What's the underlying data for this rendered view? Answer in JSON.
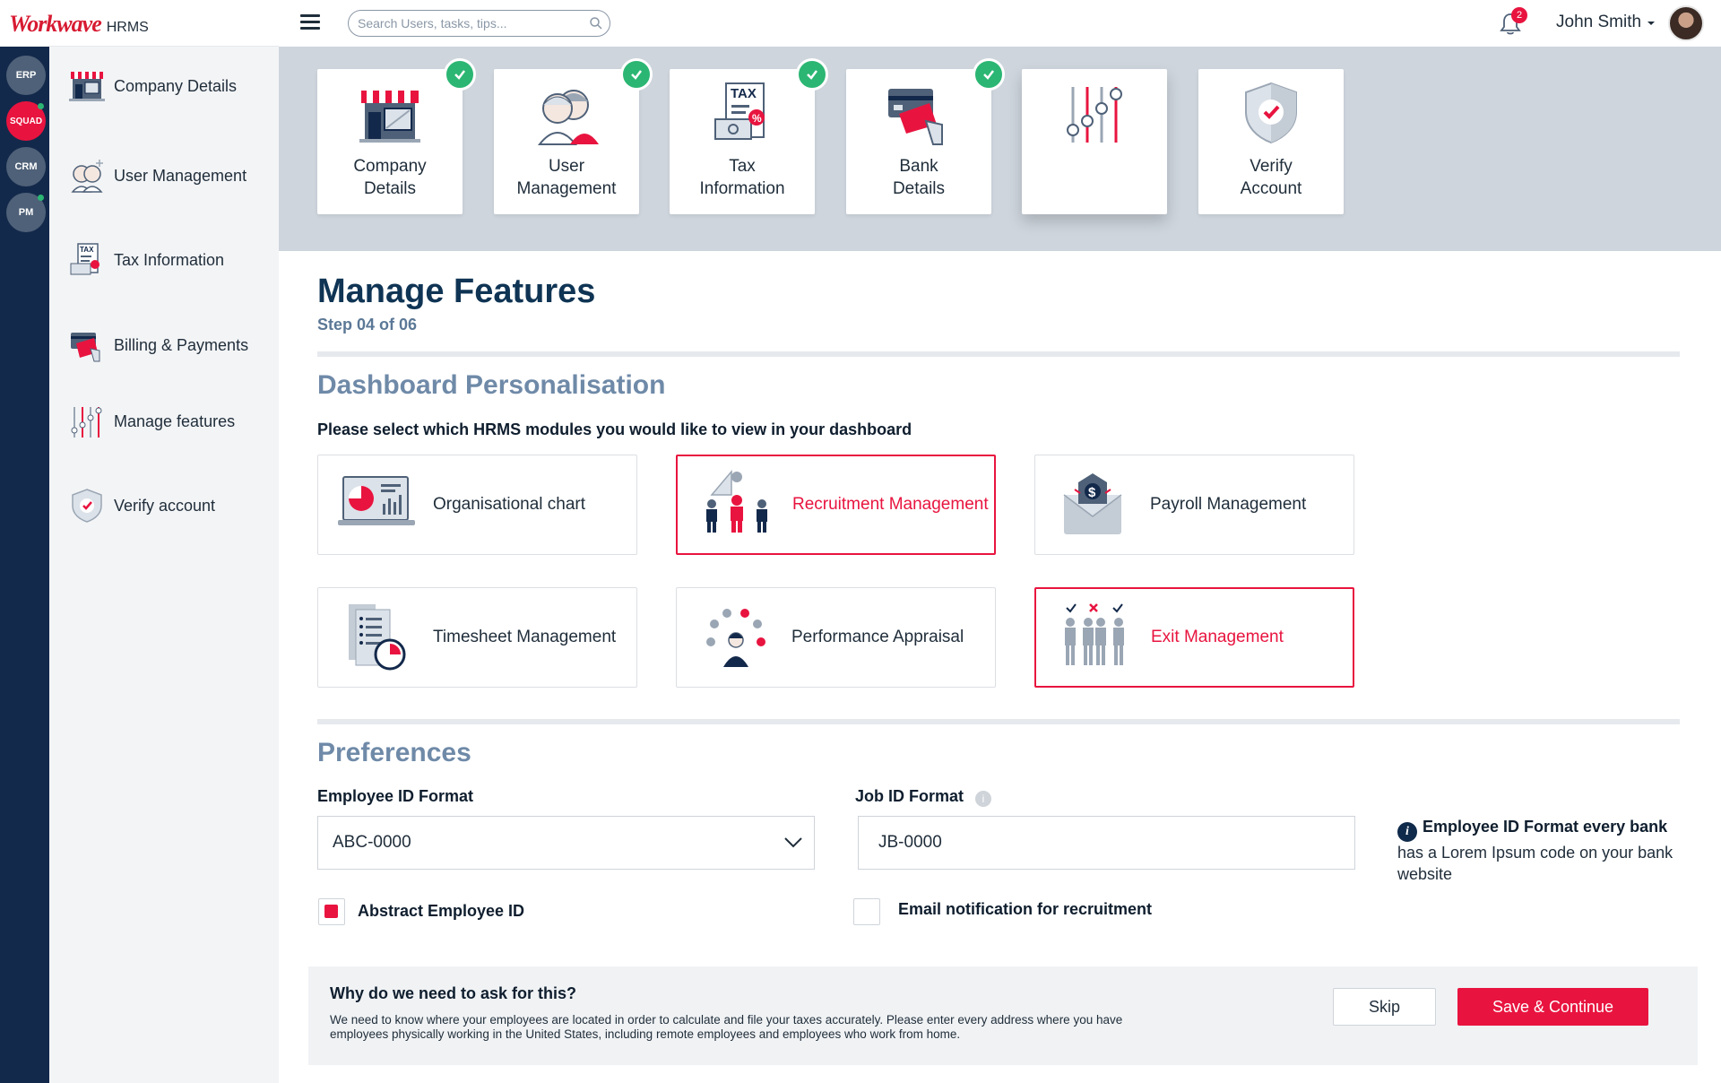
{
  "app": {
    "brand_name": "Workwave",
    "brand_suffix": "HRMS",
    "rail": [
      {
        "label": "ERP",
        "active": false
      },
      {
        "label": "SQUAD",
        "active": true
      },
      {
        "label": "CRM",
        "active": false
      },
      {
        "label": "PM",
        "active": false
      }
    ]
  },
  "sidebar": {
    "items": [
      {
        "label": "Company Details",
        "icon": "store-icon"
      },
      {
        "label": "User Management",
        "icon": "users-icon"
      },
      {
        "label": "Tax Information",
        "icon": "tax-icon"
      },
      {
        "label": "Billing & Payments",
        "icon": "card-icon"
      },
      {
        "label": "Manage features",
        "icon": "sliders-icon"
      },
      {
        "label": "Verify account",
        "icon": "shield-icon"
      }
    ]
  },
  "topbar": {
    "search_placeholder": "Search Users, tasks, tips...",
    "notifications_count": "2",
    "user_name": "John Smith"
  },
  "steps": [
    {
      "label": "Company\nDetails",
      "icon": "store-icon",
      "completed": true
    },
    {
      "label": "User\nManagement",
      "icon": "users-icon",
      "completed": true
    },
    {
      "label": "Tax\nInformation",
      "icon": "tax-icon",
      "completed": true
    },
    {
      "label": "Bank\nDetails",
      "icon": "card-icon",
      "completed": true
    },
    {
      "label": "",
      "icon": "sliders-icon",
      "completed": false
    },
    {
      "label": "Verify\nAccount",
      "icon": "shield-icon",
      "completed": false
    }
  ],
  "page": {
    "title": "Manage Features",
    "step": "Step 04 of 06",
    "section_dashboard": "Dashboard Personalisation",
    "instruction": "Please select which HRMS modules you would like to view in your dashboard",
    "section_preferences": "Preferences"
  },
  "modules": [
    {
      "label": "Organisational chart",
      "icon": "org-chart-icon",
      "selected": false
    },
    {
      "label": "Recruitment Management",
      "icon": "recruitment-icon",
      "selected": true
    },
    {
      "label": "Payroll Management",
      "icon": "payroll-icon",
      "selected": false
    },
    {
      "label": "Timesheet Management",
      "icon": "timesheet-icon",
      "selected": false
    },
    {
      "label": "Performance Appraisal",
      "icon": "appraisal-icon",
      "selected": false
    },
    {
      "label": "Exit Management",
      "icon": "exit-icon",
      "selected": true
    }
  ],
  "preferences": {
    "employee_id_label": "Employee ID Format",
    "employee_id_value": "ABC-0000",
    "job_id_label": "Job ID Format",
    "job_id_value": "JB-0000",
    "note_title": "Employee ID Format every bank",
    "note_body": "has a Lorem Ipsum code on your bank website",
    "abstract_label": "Abstract Employee ID",
    "abstract_checked": true,
    "email_label": "Email notification for recruitment",
    "email_checked": false
  },
  "footer": {
    "title": "Why do we need to ask for this?",
    "text": "We need to know where your employees are located in order to calculate and file your taxes accurately. Please enter every address where you have employees physically working in the United States, including remote employees and employees who work from home.",
    "skip_label": "Skip",
    "save_label": "Save & Continue"
  },
  "colors": {
    "accent": "#e8143f",
    "navy": "#0f3454",
    "success": "#2bb673",
    "rail": "#13294b"
  }
}
